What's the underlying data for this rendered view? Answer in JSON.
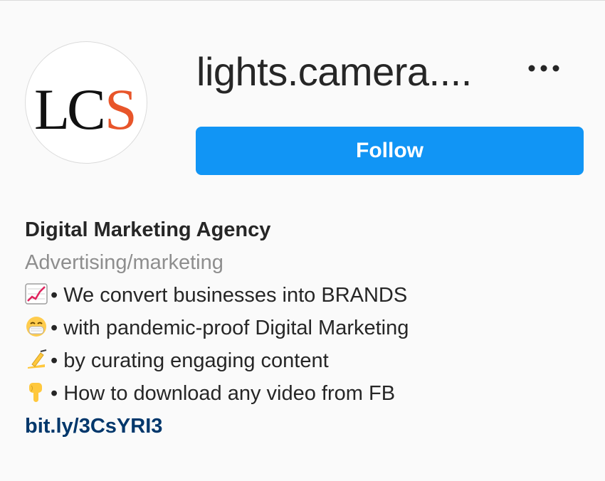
{
  "profile": {
    "username": "lights.camera....",
    "avatar_text": {
      "letter1": "L",
      "letter2": "C",
      "letter3": "S"
    },
    "follow_label": "Follow",
    "more_icon": "more-options-icon"
  },
  "bio": {
    "name": "Digital Marketing Agency",
    "category": "Advertising/marketing",
    "lines": [
      {
        "icon": "chart-increasing-icon",
        "text": "• We convert businesses into BRANDS"
      },
      {
        "icon": "face-with-mask-icon",
        "text": "• with pandemic-proof Digital Marketing"
      },
      {
        "icon": "writing-hand-icon",
        "text": "• by curating engaging content"
      },
      {
        "icon": "pointing-down-icon",
        "text": "• How to download any video from FB"
      }
    ],
    "link": "bit.ly/3CsYRI3"
  },
  "colors": {
    "follow_button": "#1195f5",
    "link": "#00376b",
    "category": "#8e8e8e",
    "logo_accent": "#e8552a"
  }
}
